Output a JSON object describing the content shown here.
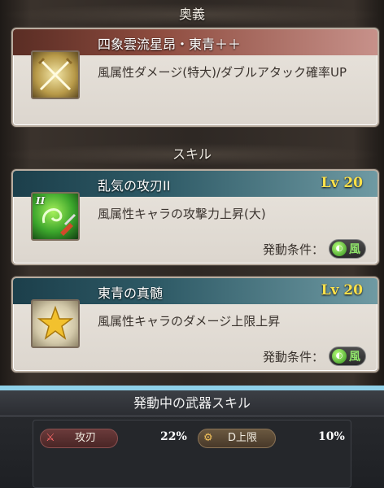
{
  "ougi": {
    "header": "奥義",
    "title": "四象雲流星昂・東青＋＋",
    "description": "風属性ダメージ(特大)/ダブルアタック確率UP",
    "icon": "crossed-swords-icon"
  },
  "skills": {
    "header": "スキル",
    "items": [
      {
        "title": "乱気の攻刃II",
        "level": "Lv 20",
        "description": "風属性キャラの攻撃力上昇(大)",
        "condition_label": "発動条件：",
        "element": "風",
        "icon": "wind-attack-skill-icon",
        "icon_badge": "II"
      },
      {
        "title": "東青の真髄",
        "level": "Lv 20",
        "description": "風属性キャラのダメージ上限上昇",
        "condition_label": "発動条件：",
        "element": "風",
        "icon": "gold-star-icon"
      }
    ]
  },
  "active_weapon_skills": {
    "title": "発動中の武器スキル",
    "stats": [
      {
        "label": "攻刃",
        "value": "22%",
        "icon": "sword-icon"
      },
      {
        "label": "D上限",
        "value": "10%",
        "icon": "gear-icon"
      }
    ]
  },
  "colors": {
    "level_yellow": "#ffe14a",
    "wind_green": "#8fe36a",
    "divider_blue": "#8fd0e8"
  }
}
